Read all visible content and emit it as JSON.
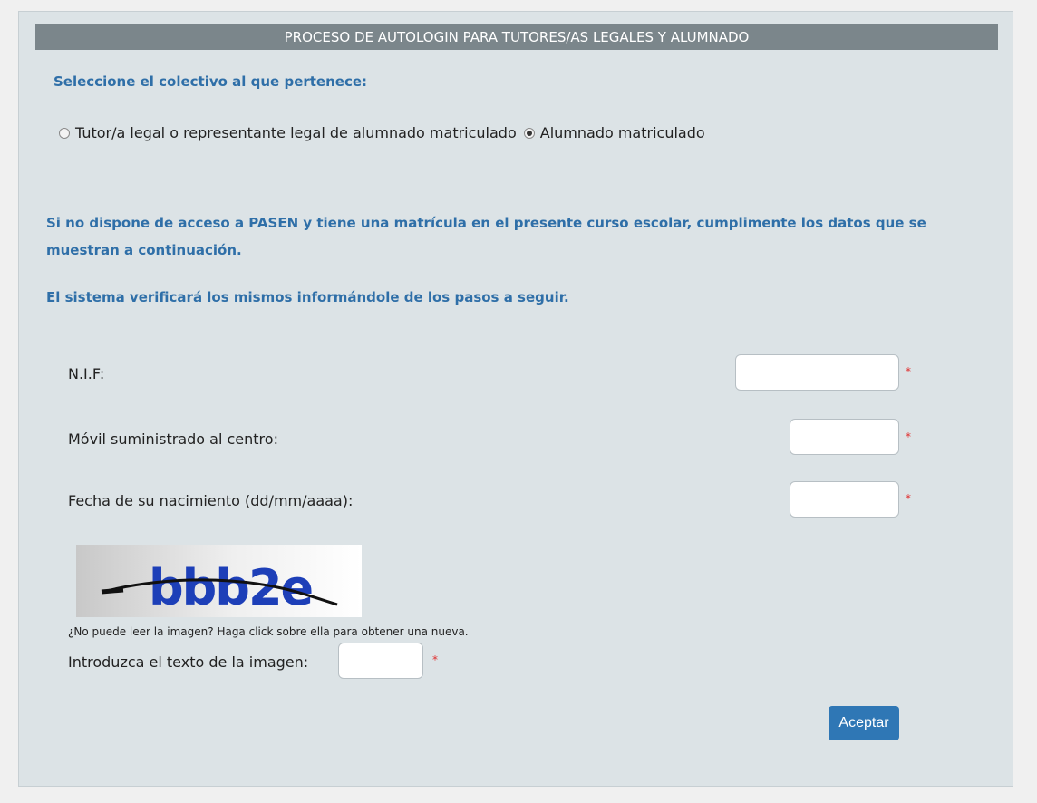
{
  "title": "PROCESO DE AUTOLOGIN PARA TUTORES/AS LEGALES Y ALUMNADO",
  "colectivo": {
    "heading": "Seleccione el colectivo al que pertenece:",
    "options": [
      {
        "label": "Tutor/a legal o representante legal de alumnado matriculado",
        "selected": false
      },
      {
        "label": "Alumnado matriculado",
        "selected": true
      }
    ]
  },
  "info": {
    "paragraph1": "Si no dispone de acceso a PASEN y tiene una matrícula en el presente curso escolar, cumplimente los datos que se muestran a continuación.",
    "paragraph2": "El sistema verificará los mismos informándole de los pasos a seguir."
  },
  "form": {
    "nif_label": "N.I.F:",
    "nif_value": "",
    "movil_label": "Móvil suministrado al centro:",
    "movil_value": "",
    "fecha_label": "Fecha de su nacimiento (dd/mm/aaaa):",
    "fecha_value": "",
    "required_mark": "*"
  },
  "captcha": {
    "image_text": "bbb2e",
    "hint": "¿No puede leer la imagen? Haga click sobre ella para obtener una nueva.",
    "input_label": "Introduzca el texto de la imagen:",
    "input_value": ""
  },
  "submit_label": "Aceptar",
  "colors": {
    "accent_text": "#2f6fa8",
    "title_bar": "#7b868b",
    "panel_bg": "#dce3e6",
    "button": "#2f77b5",
    "required": "#e03030"
  }
}
